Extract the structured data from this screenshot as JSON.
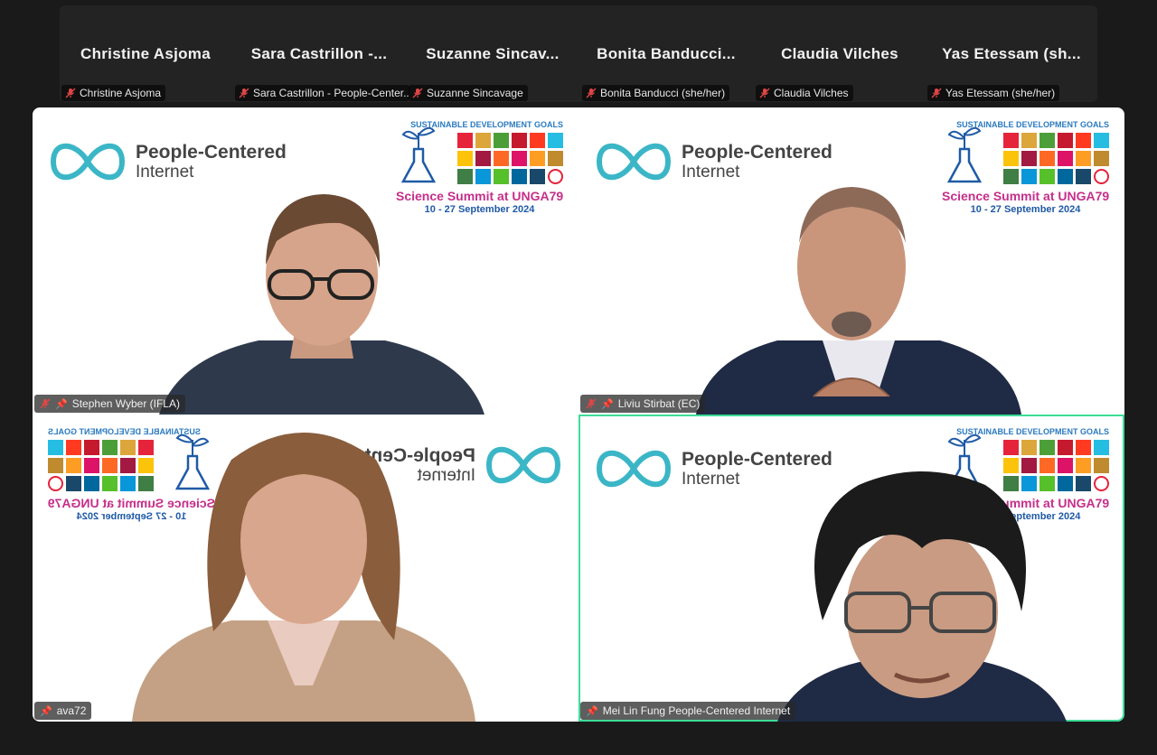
{
  "strip": {
    "participants": [
      {
        "big": "Christine Asjoma",
        "small": "Christine Asjoma"
      },
      {
        "big": "Sara Castrillon -...",
        "small": "Sara Castrillon - People-Center..."
      },
      {
        "big": "Suzanne Sincav...",
        "small": "Suzanne Sincavage"
      },
      {
        "big": "Bonita Banducci...",
        "small": "Bonita Banducci (she/her)"
      },
      {
        "big": "Claudia Vilches",
        "small": "Claudia Vilches"
      },
      {
        "big": "Yas Etessam (sh...",
        "small": "Yas Etessam (she/her)"
      }
    ]
  },
  "background": {
    "brand_line1": "People-Centered",
    "brand_line2": "Internet",
    "sdg_label": "SUSTAINABLE DEVELOPMENT GOALS",
    "summit_title": "Science Summit at UNGA79",
    "summit_dates": "10 - 27 September 2024"
  },
  "videos": [
    {
      "name": "Stephen Wyber (IFLA)"
    },
    {
      "name": "Liviu Stirbat (EC)"
    },
    {
      "name": "ava72"
    },
    {
      "name": "Mei Lin Fung People-Centered Internet"
    }
  ],
  "colors": {
    "active_speaker_border": "#3ddc97",
    "muted_mic": "#e04646",
    "summit_title": "#c62f8a",
    "summit_dates": "#1f5aa6"
  }
}
